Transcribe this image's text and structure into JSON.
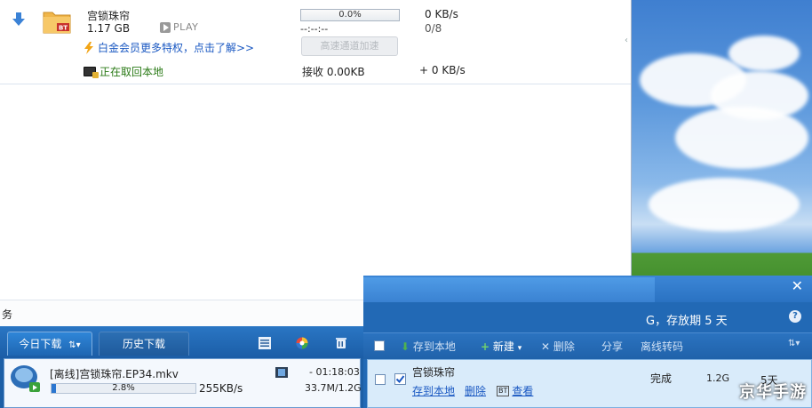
{
  "task": {
    "name": "宫锁珠帘",
    "size": "1.17 GB",
    "play_label": "PLAY",
    "progress_text": "0.0%",
    "progress_fraction": 0.0,
    "time_left": "--:--:--",
    "speed": "0 KB/s",
    "count": "0/8",
    "promo_text": "白金会员更多特权，点击了解>>",
    "boost_label": "高速通道加速",
    "retrieve_text": "正在取回本地",
    "received": "接收 0.00KB",
    "extra_speed": "+ 0 KB/s"
  },
  "main_status": {
    "text": "务"
  },
  "left_panel": {
    "tabs": [
      {
        "label": "今日下载",
        "suffix": "⇅▾"
      },
      {
        "label": "历史下载"
      }
    ],
    "item": {
      "title": "[离线]宫锁珠帘.EP34.mkv",
      "progress_text": "2.8%",
      "progress_fraction": 0.028,
      "speed": "255KB/s",
      "time": "- 01:18:03",
      "size": "33.7M/1.2G"
    }
  },
  "right_panel": {
    "retain_text": "G，存放期 5 天",
    "help": "?",
    "close": "✕",
    "toolbar": {
      "save_local": "存到本地",
      "new": "新建",
      "delete": "删除",
      "share": "分享",
      "offline_transcode": "离线转码",
      "sort": "⇅▾"
    },
    "item": {
      "name": "宫锁珠帘",
      "save_link": "存到本地",
      "delete_link": "删除",
      "view_link": "查看",
      "status": "完成",
      "size": "1.2G",
      "days": "5天"
    }
  },
  "watermark": "京华手游",
  "colors": {
    "link": "#1a58c2",
    "panel_blue": "#2269b5",
    "retrieve_green": "#2a7a16"
  }
}
